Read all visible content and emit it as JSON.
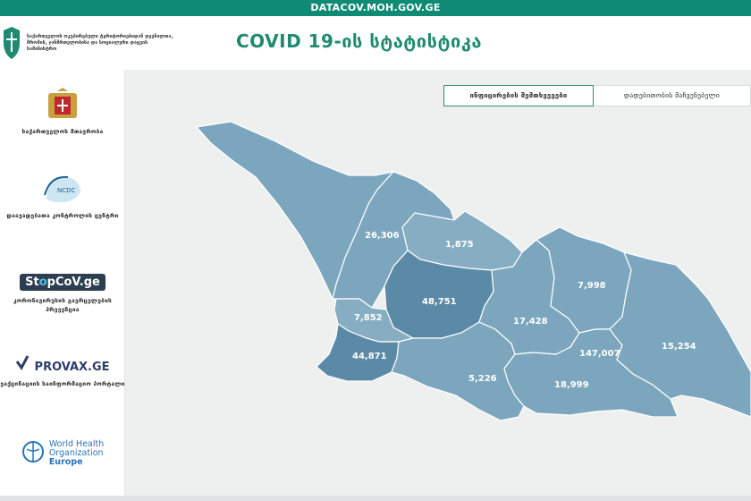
{
  "topbar": {
    "url": "DATACOV.MOH.GOV.GE"
  },
  "ministry": {
    "text": "საქართველოს ოკუპირებული ტერიტორიებიდან დევნილთა, შრომის, ჯანმრთელობისა და სოციალური დაცვის სამინისტრო"
  },
  "header": {
    "title": "COVID 19-ის სტატისტიკა"
  },
  "sidebar": {
    "items": [
      {
        "label": "საქართველოს მთავრობა",
        "icon": "government-coat-of-arms-icon"
      },
      {
        "label": "დაავადებათა კონტროლის ცენტრი",
        "icon": "ncdc-logo-icon",
        "logo_text": "NCDC"
      },
      {
        "label": "კორონავირუსის გავრცელების პრევენცია",
        "logo_text_a": "St",
        "logo_text_b": "pCoV.ge"
      },
      {
        "label": "ვაქცინაციის საინფორმაციო პორტალი",
        "logo_text": "PROVAX.GE"
      },
      {
        "label": "",
        "logo_line1": "World Health",
        "logo_line2": "Organization",
        "logo_line3": "Europe"
      }
    ]
  },
  "tabs": {
    "active": "ინფიცირების შემთხვევები",
    "other": "დადებითობის მაჩვენებელი"
  },
  "colors": {
    "brand": "#0f8a75",
    "title": "#1f8a70",
    "region": "#7ba6bd",
    "region_dark": "#5b8aa6",
    "tbilisi": "#2f5a6e",
    "border": "#ffffff"
  },
  "map": {
    "regions": [
      {
        "name": "samegrelo-zemo-svaneti",
        "label": "26,306"
      },
      {
        "name": "racha-lechkhumi",
        "label": "1,875"
      },
      {
        "name": "imereti",
        "label": "48,751"
      },
      {
        "name": "guria",
        "label": "7,852"
      },
      {
        "name": "adjara",
        "label": "44,871"
      },
      {
        "name": "samtskhe-javakheti",
        "label": "5,226"
      },
      {
        "name": "shida-kartli",
        "label": "17,428"
      },
      {
        "name": "mtskheta-mtianeti",
        "label": "7,998"
      },
      {
        "name": "tbilisi",
        "label": "147,007"
      },
      {
        "name": "kvemo-kartli",
        "label": "18,999"
      },
      {
        "name": "kakheti",
        "label": "15,254"
      }
    ]
  }
}
